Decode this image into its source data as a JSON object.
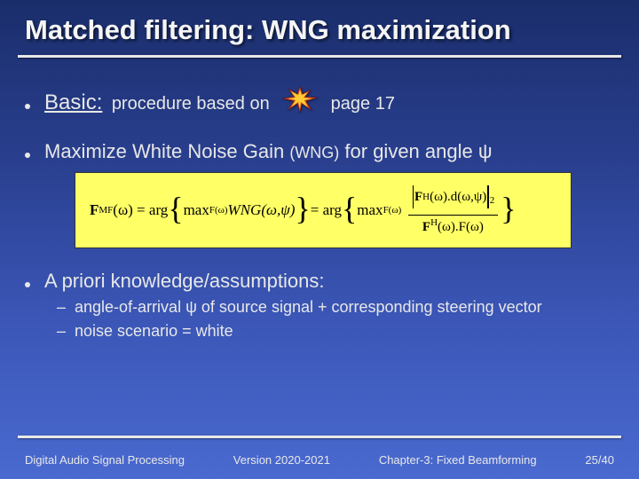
{
  "title": "Matched filtering: WNG maximization",
  "bullets": {
    "b1": {
      "basic": "Basic:",
      "proc": "procedure based on",
      "page": "page 17"
    },
    "b2": {
      "pre": "Maximize White Noise Gain ",
      "sub": "(WNG)",
      "post": " for given angle ψ"
    },
    "b3": {
      "text": "A priori knowledge/assumptions:",
      "sub1": "angle-of-arrival ψ of source signal + corresponding steering vector",
      "sub2": "noise scenario = white"
    }
  },
  "formula": {
    "lhs": "F",
    "lhs_sup": "MF",
    "arg1_pre": "(ω) = arg",
    "max1": "max",
    "max1_sub": "F(ω)",
    "wng": " WNG(ω,ψ)",
    "mid": " = arg",
    "max2": "max",
    "max2_sub": "F(ω)",
    "num_a": "F",
    "num_a_sup": "H",
    "num_b": "(ω).d(ω,ψ)",
    "den_a": "F",
    "den_a_sup": "H",
    "den_b": "(ω).F(ω)",
    "abs_sup": "2"
  },
  "footer": {
    "left": "Digital Audio Signal Processing",
    "mid": "Version 2020-2021",
    "chapter": "Chapter-3: Fixed Beamforming",
    "page": "25/40"
  }
}
